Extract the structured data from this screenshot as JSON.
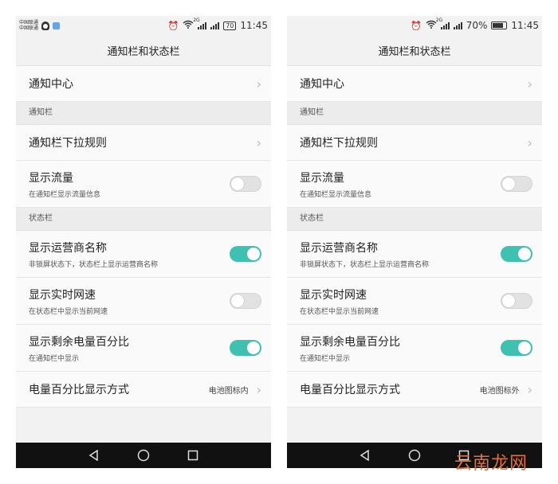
{
  "status": {
    "carrier_line1": "中国联通",
    "carrier_line2": "中国联通",
    "battery_left": "70",
    "battery_right": "70%",
    "time": "11:45",
    "net_type": "2G"
  },
  "screen_title": "通知栏和状态栏",
  "items": {
    "notification_center": "通知中心",
    "section_notification": "通知栏",
    "pulldown_rule": "通知栏下拉规则",
    "show_traffic": "显示流量",
    "show_traffic_sub": "在通知栏显示流量信息",
    "section_status": "状态栏",
    "show_carrier": "显示运营商名称",
    "show_carrier_sub": "非锁屏状态下，状态栏上显示运营商名称",
    "show_speed": "显示实时网速",
    "show_speed_sub": "在状态栏中显示当前网速",
    "show_battery_pct": "显示剩余电量百分比",
    "show_battery_pct_sub": "在通知栏中显示",
    "battery_pct_mode": "电量百分比显示方式"
  },
  "values": {
    "left_battery_mode": "电池图标内",
    "right_battery_mode": "电池图标外"
  },
  "toggles": {
    "show_traffic": false,
    "show_carrier": true,
    "show_speed": false,
    "show_battery_pct": true
  },
  "colors": {
    "toggle_on": "#3ec1b1",
    "watermark": "#e0703b"
  },
  "watermark": "云南龙网"
}
